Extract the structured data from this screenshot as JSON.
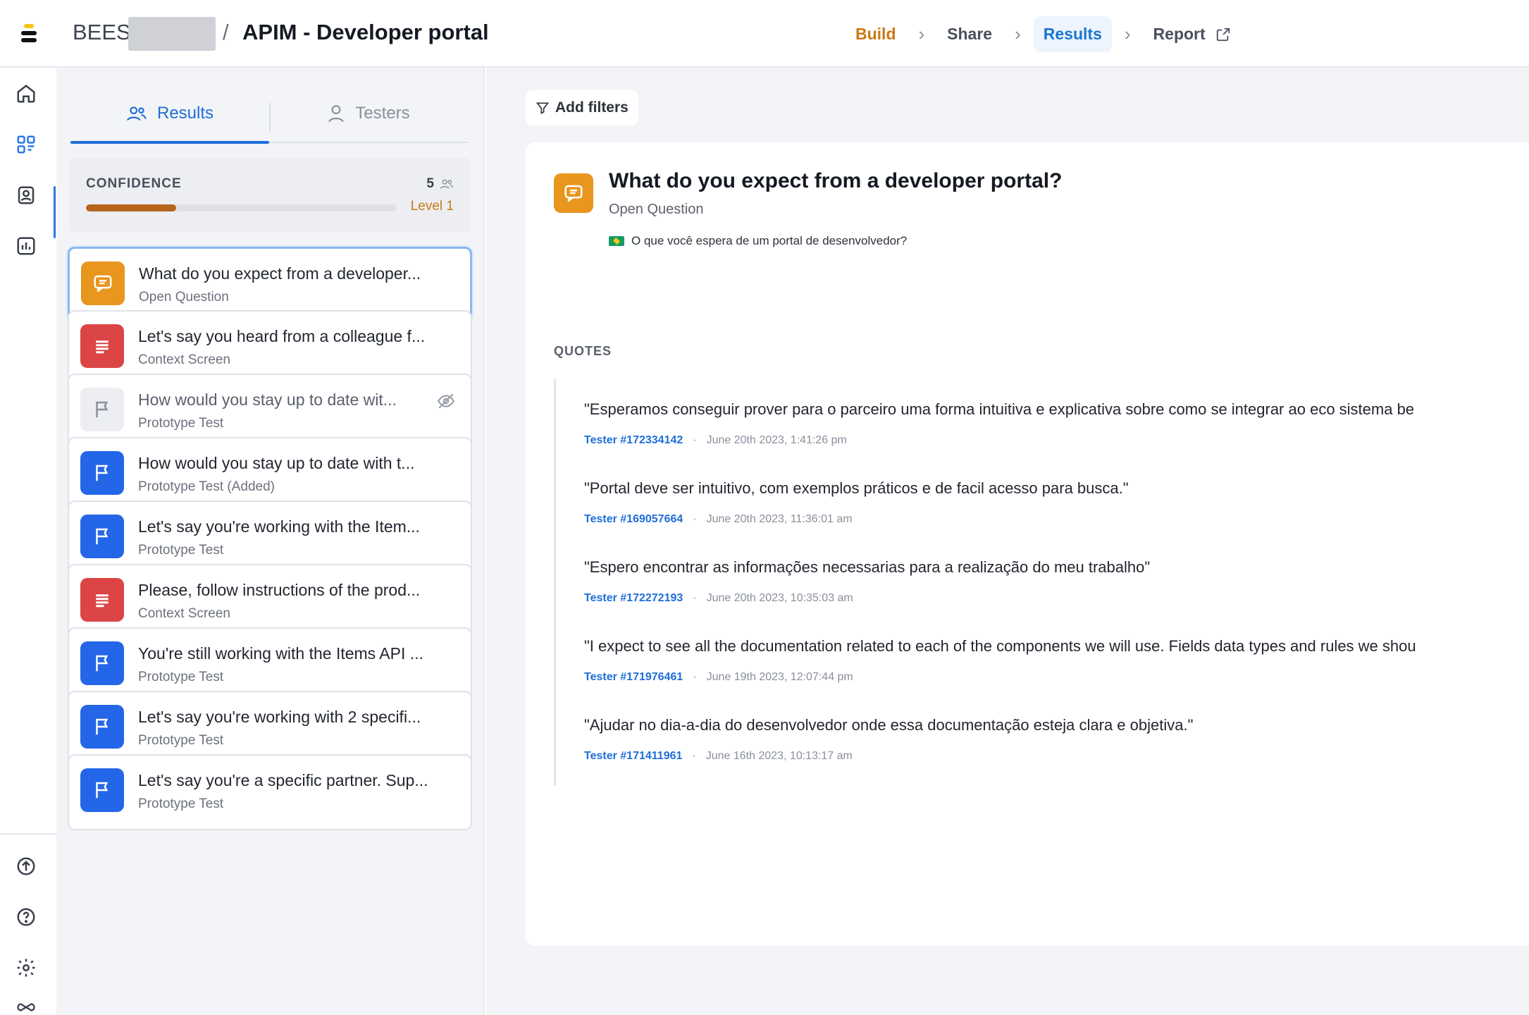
{
  "header": {
    "org": "BEES",
    "separator": "/",
    "project": "APIM - Developer portal",
    "steps": [
      "Build",
      "Share",
      "Results",
      "Report"
    ],
    "active_step": "Results"
  },
  "rail": {
    "icons": [
      "home-icon",
      "grid-icon",
      "contacts-icon",
      "analytics-icon",
      "upload-icon",
      "help-icon",
      "settings-icon",
      "infinity-icon"
    ]
  },
  "left_panel": {
    "tabs": [
      {
        "label": "Results",
        "icon": "users-icon",
        "active": true
      },
      {
        "label": "Testers",
        "icon": "user-icon",
        "active": false
      }
    ],
    "confidence": {
      "label": "CONFIDENCE",
      "count": "5",
      "level": "Level 1",
      "progress": 0.29
    },
    "questions": [
      {
        "title": "What do you expect from a developer...",
        "type": "Open Question",
        "icon": "message-icon",
        "color": "orange",
        "selected": true
      },
      {
        "title": "Let's say you heard from a colleague f...",
        "type": "Context Screen",
        "icon": "text-lines-icon",
        "color": "red"
      },
      {
        "title": "How would you stay up to date wit...",
        "type": "Prototype Test",
        "icon": "flag-icon",
        "color": "grey",
        "hidden": true
      },
      {
        "title": "How would you stay up to date with t...",
        "type": "Prototype Test (Added)",
        "icon": "flag-icon",
        "color": "blue"
      },
      {
        "title": "Let's say you're working with the Item...",
        "type": "Prototype Test",
        "icon": "flag-icon",
        "color": "blue"
      },
      {
        "title": "Please, follow instructions of the prod...",
        "type": "Context Screen",
        "icon": "text-lines-icon",
        "color": "red"
      },
      {
        "title": "You're still working with the Items API ...",
        "type": "Prototype Test",
        "icon": "flag-icon",
        "color": "blue"
      },
      {
        "title": "Let's say you're working with 2 specifi...",
        "type": "Prototype Test",
        "icon": "flag-icon",
        "color": "blue"
      },
      {
        "title": "Let's say you're a specific partner. Sup...",
        "type": "Prototype Test",
        "icon": "flag-icon",
        "color": "blue"
      }
    ]
  },
  "main": {
    "filters_label": "Add filters",
    "question": {
      "title": "What do you expect from a developer portal?",
      "type": "Open Question",
      "translation": "O que você espera de um portal de desenvolvedor?"
    },
    "quotes_label": "QUOTES",
    "quotes": [
      {
        "text": "\"Esperamos conseguir prover para o parceiro uma forma intuitiva e explicativa sobre como se integrar ao eco sistema be",
        "tester": "Tester #172334142",
        "date": "June 20th 2023, 1:41:26 pm"
      },
      {
        "text": "\"Portal deve ser intuitivo, com exemplos práticos e de facil acesso para busca.\"",
        "tester": "Tester #169057664",
        "date": "June 20th 2023, 11:36:01 am"
      },
      {
        "text": "\"Espero encontrar as informações necessarias para a realização do meu trabalho\"",
        "tester": "Tester #172272193",
        "date": "June 20th 2023, 10:35:03 am"
      },
      {
        "text": "\"I expect to see all the documentation related to each of the components we will use. Fields data types and rules we shou",
        "tester": "Tester #171976461",
        "date": "June 19th 2023, 12:07:44 pm"
      },
      {
        "text": "\"Ajudar no dia-a-dia do desenvolvedor onde essa documentação esteja clara e objetiva.\"",
        "tester": "Tester #171411961",
        "date": "June 16th 2023, 10:13:17 am"
      }
    ]
  },
  "colors": {
    "accent_blue": "#1e6ed8",
    "build_orange": "#c97a12",
    "open_question": "#e8961e",
    "context_screen": "#dc4545",
    "prototype_test": "#2466e8"
  }
}
